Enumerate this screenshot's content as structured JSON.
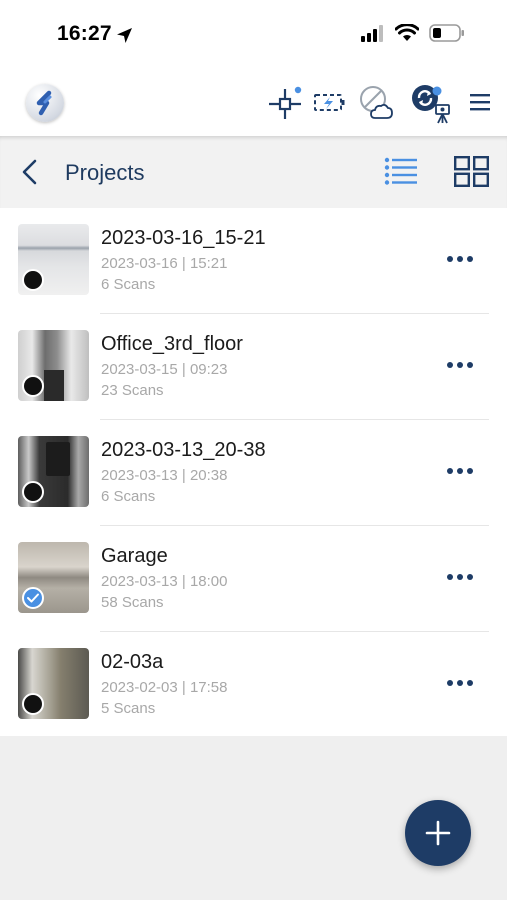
{
  "status_bar": {
    "time": "16:27"
  },
  "header": {
    "icons": [
      "app-logo",
      "crosshair-icon",
      "battery-charging-icon",
      "cloud-off-icon",
      "sync-scanner-icon",
      "menu-icon"
    ]
  },
  "subheader": {
    "title": "Projects",
    "active_view": "list"
  },
  "projects": [
    {
      "name": "2023-03-16_15-21",
      "datetime": "2023-03-16 | 15:21",
      "scans": "6 Scans",
      "selected": false
    },
    {
      "name": "Office_3rd_floor",
      "datetime": "2023-03-15 | 09:23",
      "scans": "23 Scans",
      "selected": false
    },
    {
      "name": "2023-03-13_20-38",
      "datetime": "2023-03-13 | 20:38",
      "scans": "6 Scans",
      "selected": false
    },
    {
      "name": "Garage",
      "datetime": "2023-03-13 | 18:00",
      "scans": "58 Scans",
      "selected": true
    },
    {
      "name": "02-03a",
      "datetime": "2023-02-03 | 17:58",
      "scans": "5 Scans",
      "selected": false
    }
  ],
  "colors": {
    "primary": "#1e3c66",
    "accent": "#4a90e2",
    "muted_text": "#a8a8a8"
  }
}
